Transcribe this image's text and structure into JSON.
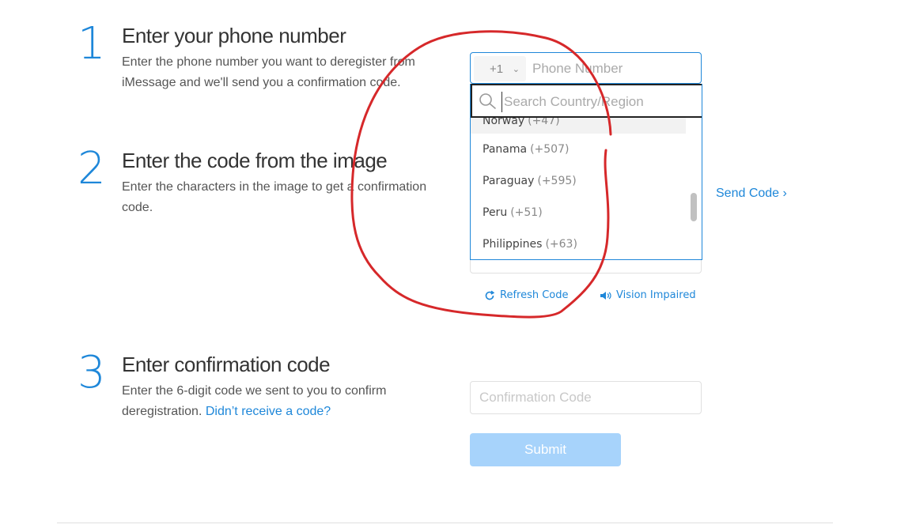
{
  "step1": {
    "number": "1",
    "title": "Enter your phone number",
    "description": "Enter the phone number you want to deregister from iMessage and we'll send you a confirmation code.",
    "country_code": "+1",
    "phone_placeholder": "Phone Number"
  },
  "dropdown": {
    "search_placeholder": "Search Country/Region",
    "countries": [
      {
        "name": "Norway",
        "code": "(+47)"
      },
      {
        "name": "Panama",
        "code": "(+507)"
      },
      {
        "name": "Paraguay",
        "code": "(+595)"
      },
      {
        "name": "Peru",
        "code": "(+51)"
      },
      {
        "name": "Philippines",
        "code": "(+63)"
      }
    ]
  },
  "step2": {
    "number": "2",
    "title": "Enter the code from the image",
    "description": "Enter the characters in the image to get a confirmation code.",
    "send_code": "Send Code",
    "refresh_code": "Refresh Code",
    "vision_impaired": "Vision Impaired"
  },
  "step3": {
    "number": "3",
    "title": "Enter confirmation code",
    "description": "Enter the 6-digit code we sent to you to confirm deregistration.",
    "didnt_receive": "Didn’t receive a code?",
    "confirm_placeholder": "Confirmation Code",
    "submit": "Submit"
  },
  "colors": {
    "accent": "#1e87d9",
    "submit_disabled": "#a7d3fb",
    "annotation": "#d6282a"
  },
  "icons": {
    "search": "search-icon",
    "refresh": "refresh-icon",
    "speaker": "speaker-icon",
    "chevron_right": "chevron-right-icon",
    "chevron_down": "chevron-down-icon"
  }
}
